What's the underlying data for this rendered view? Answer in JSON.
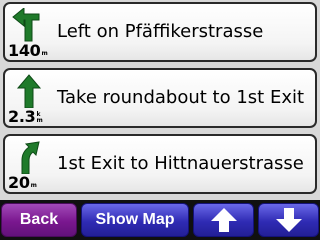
{
  "turns": [
    {
      "instruction": "Left on Pfäffikerstrasse",
      "distance": "140",
      "unit": "m",
      "maneuver_icon": "turn-left-icon"
    },
    {
      "instruction": "Take roundabout to 1st Exit",
      "distance": "2.3",
      "unit": "km",
      "unit_top": "k",
      "unit_bottom": "m",
      "maneuver_icon": "straight-arrow-icon"
    },
    {
      "instruction": "1st Exit to Hittnauerstrasse",
      "distance": "20",
      "unit": "m",
      "maneuver_icon": "bear-right-icon"
    }
  ],
  "buttons": {
    "back": "Back",
    "show_map": "Show Map",
    "scroll_up_icon": "up-arrow-icon",
    "scroll_down_icon": "down-arrow-icon"
  },
  "colors": {
    "arrow_green": "#1f7a2a",
    "back_button": "#7a178f",
    "nav_button": "#2f2bb4"
  }
}
